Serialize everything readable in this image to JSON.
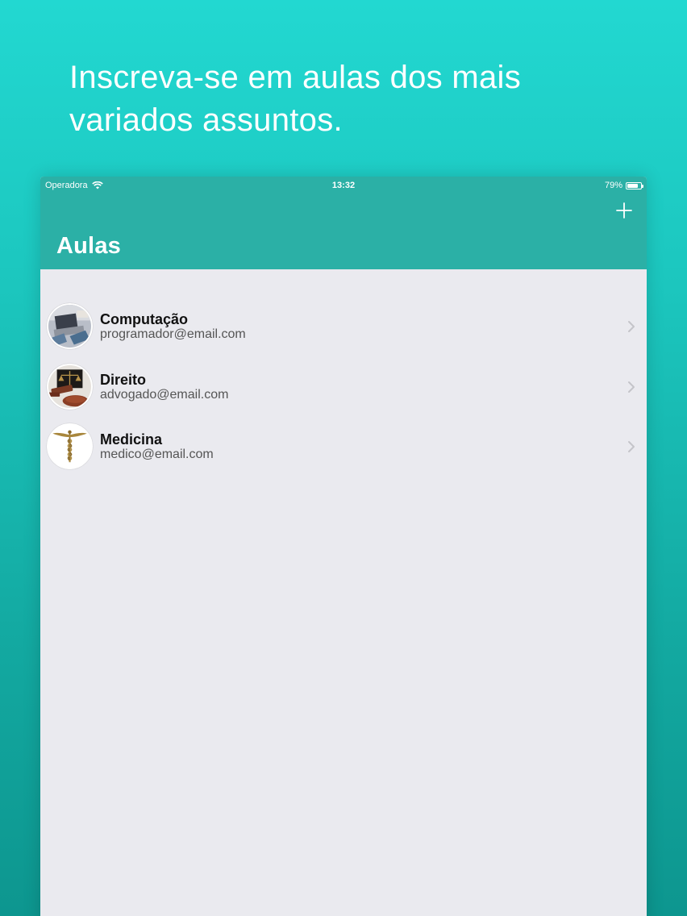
{
  "promo": {
    "headline_line1": "Inscreva-se em aulas dos mais",
    "headline_line2": "variados assuntos."
  },
  "status_bar": {
    "carrier": "Operadora",
    "time": "13:32",
    "battery": "79%",
    "battery_level": 0.79
  },
  "nav": {
    "title": "Aulas",
    "add_icon": "plus-icon"
  },
  "classes": [
    {
      "title": "Computação",
      "email": "programador@email.com",
      "image": "laptop-photo"
    },
    {
      "title": "Direito",
      "email": "advogado@email.com",
      "image": "gavel-scales-photo"
    },
    {
      "title": "Medicina",
      "email": "medico@email.com",
      "image": "caduceus-symbol"
    }
  ],
  "colors": {
    "background_top": "#22d8d1",
    "background_bottom": "#0d968f",
    "nav_bar": "#2bb0a6",
    "list_background": "#eaeaef"
  }
}
